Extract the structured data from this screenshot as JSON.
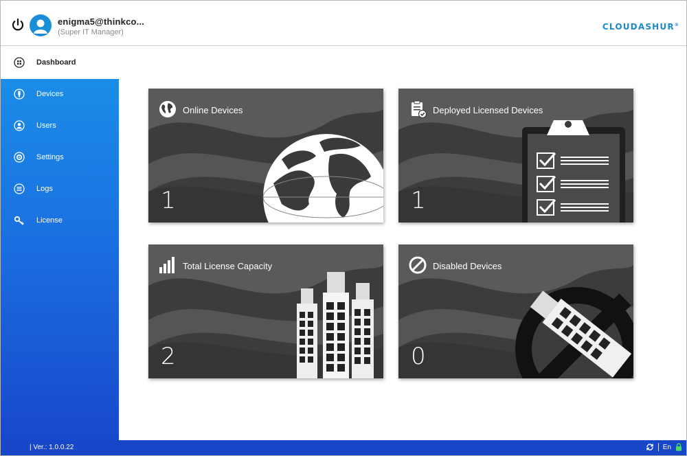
{
  "window": {
    "controls": [
      "–",
      "□",
      "✕"
    ]
  },
  "header": {
    "user_name": "enigma5@thinkco...",
    "user_role": "(Super IT Manager)",
    "brand": "CLOUDASHUR",
    "brand_mark": "®"
  },
  "sidebar": {
    "items": [
      {
        "label": "Dashboard",
        "icon": "dashboard-icon",
        "active": true
      },
      {
        "label": "Devices",
        "icon": "usb-icon"
      },
      {
        "label": "Users",
        "icon": "user-icon"
      },
      {
        "label": "Settings",
        "icon": "gear-icon"
      },
      {
        "label": "Logs",
        "icon": "list-icon"
      },
      {
        "label": "License",
        "icon": "key-icon"
      }
    ]
  },
  "cards": [
    {
      "title": "Online Devices",
      "count": "1",
      "icon": "globe-icon"
    },
    {
      "title": "Deployed Licensed Devices",
      "count": "1",
      "icon": "clipboard-check-icon"
    },
    {
      "title": "Total License Capacity",
      "count": "2",
      "icon": "signal-bars-icon"
    },
    {
      "title": "Disabled Devices",
      "count": "0",
      "icon": "disabled-icon"
    }
  ],
  "statusbar": {
    "version": "| Ver.:  1.0.0.22",
    "language": "En",
    "colors": {
      "bar": "#1746c9",
      "lock": "#4cd964"
    }
  }
}
